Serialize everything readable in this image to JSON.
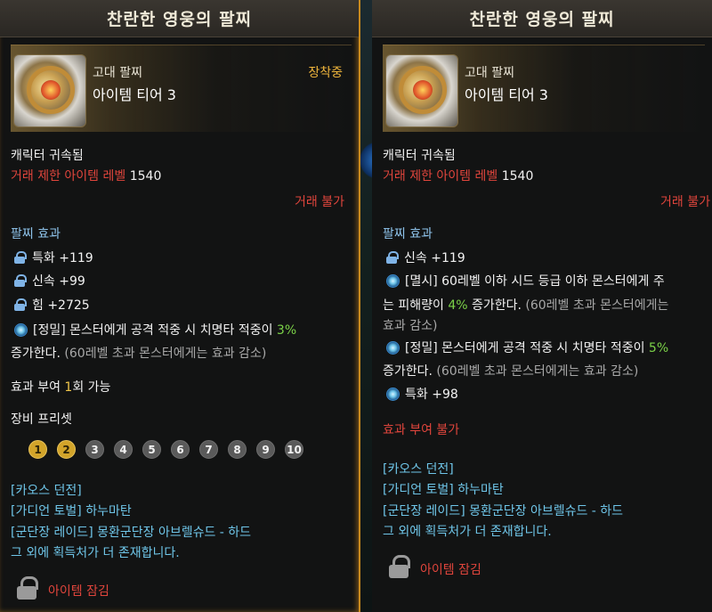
{
  "left": {
    "title": "찬란한 영웅의 팔찌",
    "grade": "고대 팔찌",
    "tier": "아이템 티어 3",
    "equipped": "장착중",
    "bound": "캐릭터 귀속됨",
    "trade_level_label": "거래 제한 아이템 레벨",
    "trade_level_value": "1540",
    "trade_status": "거래 불가",
    "effect_header": "팔찌 효과",
    "stats": [
      {
        "label": "특화 +119"
      },
      {
        "label": "신속 +99"
      },
      {
        "label": "힘 +2725"
      }
    ],
    "special_prefix": "[정밀] 몬스터에게 공격 적중 시 치명타 적중이 ",
    "special_value": "3%",
    "special_suffix_1": "증가한다.",
    "special_suffix_2": " (60레벨 초과 몬스터에게는 효과 감소)",
    "grant_prefix": "효과 부여 ",
    "grant_count": "1",
    "grant_suffix": "회 가능",
    "preset_header": "장비 프리셋",
    "presets": [
      "1",
      "2",
      "3",
      "4",
      "5",
      "6",
      "7",
      "8",
      "9",
      "10"
    ],
    "sources": [
      "[카오스 던전]",
      "[가디언 토벌] 하누마탄",
      "[군단장 레이드] 몽환군단장 아브렐슈드 - 하드",
      "그 외에 획득처가 더 존재합니다."
    ],
    "lock_label": "아이템 잠김"
  },
  "right": {
    "title": "찬란한 영웅의 팔찌",
    "grade": "고대 팔찌",
    "tier": "아이템 티어 3",
    "bound": "캐릭터 귀속됨",
    "trade_level_label": "거래 제한 아이템 레벨",
    "trade_level_value": "1540",
    "trade_status": "거래 불가",
    "effect_header": "팔찌 효과",
    "stat1": "신속 +119",
    "eff1_line1": "[멸시] 60레벨 이하 시드 등급 이하 몬스터에게 주",
    "eff1_prefix": "는 피해량이 ",
    "eff1_value": "4%",
    "eff1_suffix": " 증가한다.",
    "eff1_note": " (60레벨 초과 몬스터에게는",
    "eff1_note2": "효과 감소)",
    "eff2_prefix": "[정밀] 몬스터에게 공격 적중 시 치명타 적중이 ",
    "eff2_value": "5%",
    "eff2_suffix_1": "증가한다.",
    "eff2_suffix_2": " (60레벨 초과 몬스터에게는 효과 감소)",
    "stat2": "특화 +98",
    "grant": "효과 부여 불가",
    "sources": [
      "[카오스 던전]",
      "[가디언 토벌] 하누마탄",
      "[군단장 레이드] 몽환군단장 아브렐슈드 - 하드",
      "그 외에 획득처가 더 존재합니다."
    ],
    "lock_label": "아이템 잠김"
  }
}
